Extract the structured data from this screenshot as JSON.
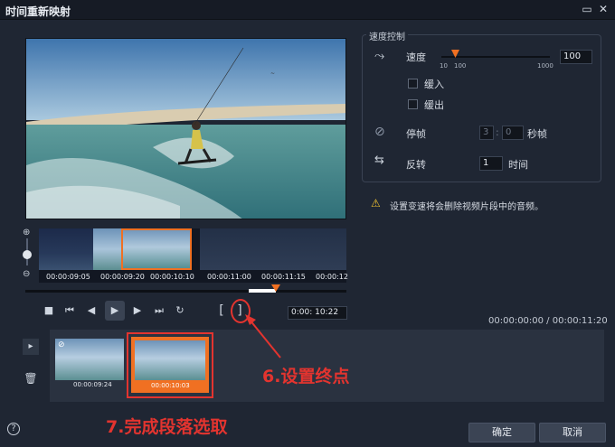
{
  "window": {
    "title": "时间重新映射"
  },
  "filmstrip": {
    "timecodes": [
      "00:00:09:05",
      "00:00:09:20",
      "00:00:10:10",
      "00:00:11:00",
      "00:00:11:15",
      "00:00:12"
    ]
  },
  "playback": {
    "timecode": "0:00: 10:22",
    "range": "00:00:00:00 / 00:00:11:20"
  },
  "speed": {
    "group_label": "速度控制",
    "speed_label": "速度",
    "value": "100",
    "scale_min": "10",
    "scale_mid": "100",
    "scale_max": "1000",
    "ease_in": "缓入",
    "ease_out": "缓出"
  },
  "freeze": {
    "label": "停帧",
    "value": "3",
    "frames_value": "0",
    "unit": "秒帧"
  },
  "reverse": {
    "label": "反转",
    "value": "1",
    "unit": "时间"
  },
  "warning": {
    "text": "设置变速将会删除视频片段中的音频。"
  },
  "clips": [
    {
      "timecode": "00:00:09:24"
    },
    {
      "timecode": "00:00:10:03"
    }
  ],
  "annotations": {
    "set_end": "6.设置终点",
    "complete": "7.完成段落选取"
  },
  "footer": {
    "ok": "确定",
    "cancel": "取消"
  },
  "colors": {
    "accent": "#f07022",
    "annotation": "#e3342f",
    "background": "#1f2633"
  }
}
